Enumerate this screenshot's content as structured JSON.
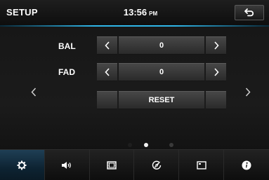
{
  "header": {
    "title": "SETUP",
    "time": "13:56",
    "ampm": "PM",
    "back_icon": "back-arrow-icon"
  },
  "balance": {
    "label": "BAL",
    "value": "0",
    "left_icon": "chevron-left-icon",
    "right_icon": "chevron-right-icon"
  },
  "fader": {
    "label": "FAD",
    "value": "0",
    "left_icon": "chevron-left-icon",
    "right_icon": "chevron-right-icon"
  },
  "reset": {
    "label": "RESET"
  },
  "navigation": {
    "prev_icon": "chevron-left-icon",
    "next_icon": "chevron-right-icon"
  },
  "pager": {
    "total_pages": 3,
    "current_page": 2
  },
  "bottom_tabs": [
    {
      "id": "general",
      "icon": "gear-icon",
      "active": true
    },
    {
      "id": "audio",
      "icon": "speaker-icon",
      "active": false
    },
    {
      "id": "video",
      "icon": "film-icon",
      "active": false
    },
    {
      "id": "navigation",
      "icon": "compass-icon",
      "active": false
    },
    {
      "id": "display",
      "icon": "screen-icon",
      "active": false
    },
    {
      "id": "info",
      "icon": "info-icon",
      "active": false
    }
  ],
  "colors": {
    "accent": "#2fb6e8",
    "active_tab": "#0d2332",
    "text": "#ffffff"
  }
}
